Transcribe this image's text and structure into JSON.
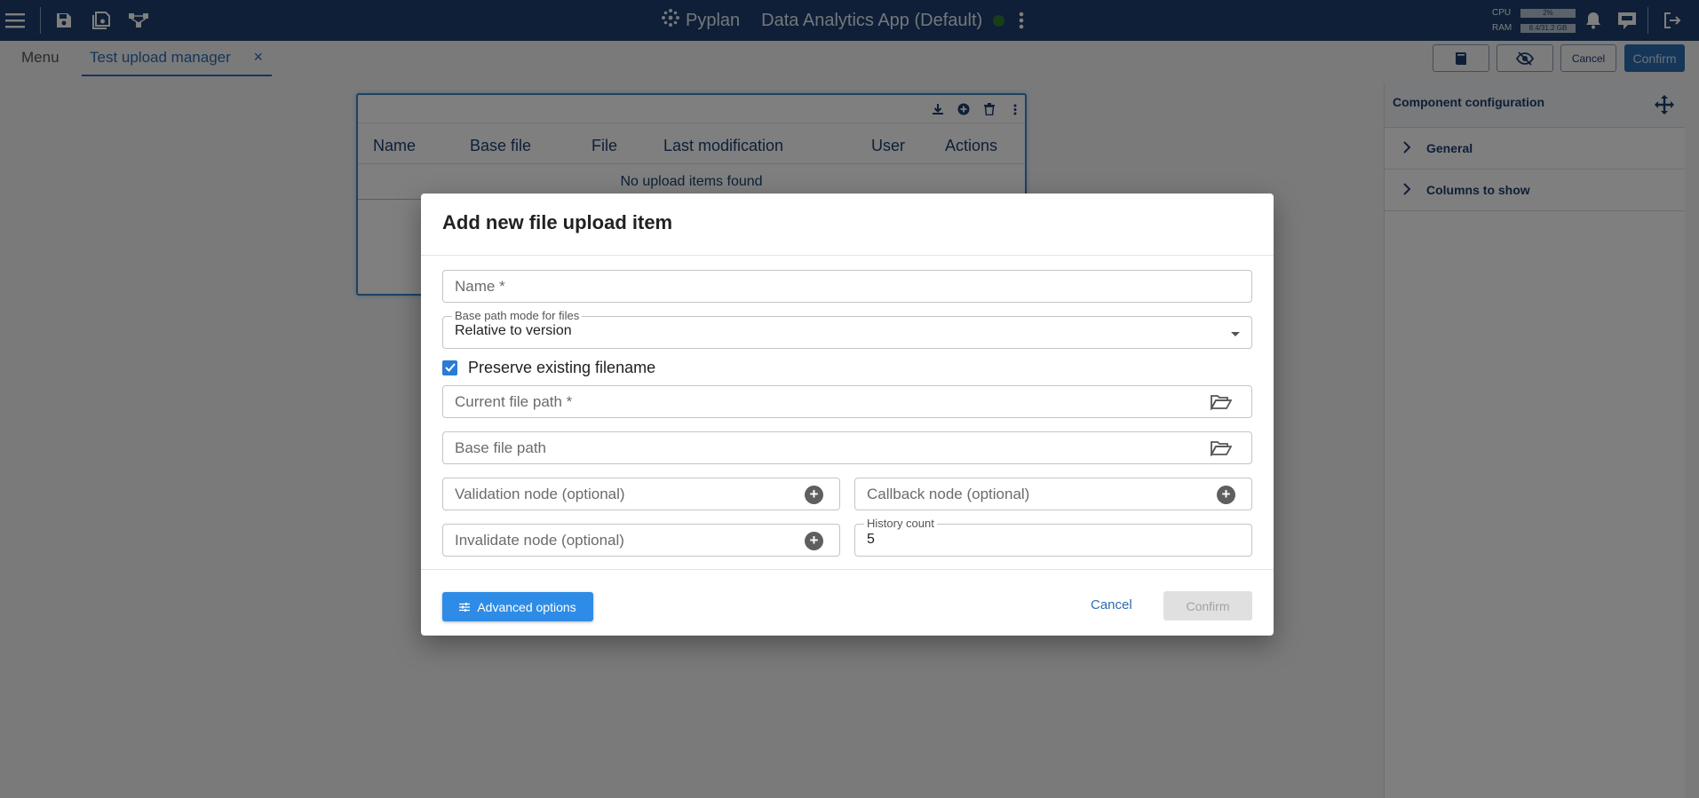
{
  "topbar": {
    "brand": "Pyplan",
    "app_title": "Data Analytics App (Default)",
    "cpu_label": "CPU",
    "cpu_value": "2%",
    "ram_label": "RAM",
    "ram_value": "8.4/31.2 GB",
    "status_color": "#2e7d32"
  },
  "tabbar": {
    "menu_label": "Menu",
    "active_tab": "Test upload manager",
    "close_glyph": "×",
    "cancel_label": "Cancel",
    "confirm_label": "Confirm"
  },
  "component": {
    "columns": [
      "Name",
      "Base file",
      "File",
      "Last modification",
      "User",
      "Actions"
    ],
    "empty_text": "No upload items found"
  },
  "right_panel": {
    "title": "Component configuration",
    "sections": [
      "General",
      "Columns to show"
    ]
  },
  "dialog": {
    "title": "Add new file upload item",
    "name_placeholder": "Name *",
    "base_path_label": "Base path mode for files",
    "base_path_value": "Relative to version",
    "preserve_label": "Preserve existing filename",
    "preserve_checked": true,
    "current_file_placeholder": "Current file path *",
    "base_file_placeholder": "Base file path",
    "validation_placeholder": "Validation node (optional)",
    "callback_placeholder": "Callback node (optional)",
    "invalidate_placeholder": "Invalidate node (optional)",
    "history_label": "History count",
    "history_value": "5",
    "advanced_label": "Advanced options",
    "cancel_label": "Cancel",
    "confirm_label": "Confirm"
  },
  "colors": {
    "topbar": "#1d3f6e",
    "accent": "#2b6cb0",
    "advanced_button": "#2f8ce6",
    "checkbox": "#2b7ad6"
  }
}
